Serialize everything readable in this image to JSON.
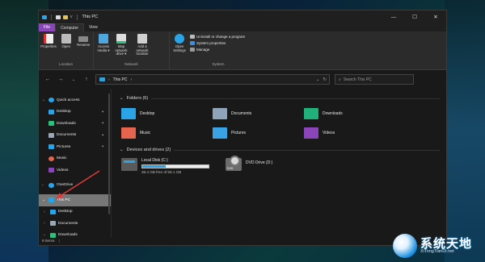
{
  "window": {
    "title": "This PC",
    "quick_access_caret": "v"
  },
  "window_controls": {
    "minimize": "—",
    "maximize": "☐",
    "close": "✕"
  },
  "tabs": [
    {
      "label": "File"
    },
    {
      "label": "Computer"
    },
    {
      "label": "View"
    }
  ],
  "ribbon": {
    "location": {
      "label": "Location",
      "buttons": [
        {
          "label": "Properties"
        },
        {
          "label": "Open"
        },
        {
          "label": "Rename"
        }
      ]
    },
    "network": {
      "label": "Network",
      "buttons": [
        {
          "label": "Access media ▾"
        },
        {
          "label": "Map network drive ▾"
        },
        {
          "label": "Add a network location"
        }
      ]
    },
    "system": {
      "label": "System",
      "open_settings": "Open Settings",
      "items": [
        {
          "label": "Uninstall or change a program"
        },
        {
          "label": "System properties"
        },
        {
          "label": "Manage"
        }
      ]
    }
  },
  "address": {
    "path": "This PC",
    "search_placeholder": "Search This PC"
  },
  "sidebar": {
    "items": [
      {
        "label": "Quick access",
        "icon": "star-icon",
        "color": "#2aa4e6"
      },
      {
        "label": "Desktop",
        "icon": "desktop-icon",
        "color": "#2aa4e6",
        "pinned": true
      },
      {
        "label": "Downloads",
        "icon": "downloads-icon",
        "color": "#2fbf7f",
        "pinned": true
      },
      {
        "label": "Documents",
        "icon": "documents-icon",
        "color": "#9aa7b5",
        "pinned": true
      },
      {
        "label": "Pictures",
        "icon": "pictures-icon",
        "color": "#2aa4e6",
        "pinned": true
      },
      {
        "label": "Music",
        "icon": "music-icon",
        "color": "#e5644e"
      },
      {
        "label": "Videos",
        "icon": "videos-icon",
        "color": "#8a46b8"
      },
      {
        "label": "OneDrive",
        "icon": "onedrive-icon",
        "color": "#2aa4e6"
      },
      {
        "label": "This PC",
        "icon": "this-pc-icon",
        "color": "#2aa4e6"
      },
      {
        "label": "Desktop",
        "icon": "desktop-icon",
        "color": "#2aa4e6"
      },
      {
        "label": "Documents",
        "icon": "documents-icon",
        "color": "#9aa7b5"
      },
      {
        "label": "Downloads",
        "icon": "downloads-icon",
        "color": "#2fbf7f"
      }
    ]
  },
  "folders": {
    "header": "Folders (6)",
    "items": [
      {
        "label": "Desktop",
        "icon": "desktop-folder-icon",
        "color": "#2aa4e6"
      },
      {
        "label": "Documents",
        "icon": "documents-folder-icon",
        "color": "#8fa4b8"
      },
      {
        "label": "Downloads",
        "icon": "downloads-folder-icon",
        "color": "#22b07a"
      },
      {
        "label": "Music",
        "icon": "music-folder-icon",
        "color": "#e5644e"
      },
      {
        "label": "Pictures",
        "icon": "pictures-folder-icon",
        "color": "#3aa3e6"
      },
      {
        "label": "Videos",
        "icon": "videos-folder-icon",
        "color": "#8a46b8"
      }
    ]
  },
  "drives": {
    "header": "Devices and drives (2)",
    "local": {
      "label": "Local Disk (C:)",
      "free": "38.4 GB free of 59.1 GB",
      "used_fraction": 0.35
    },
    "dvd": {
      "label": "DVD Drive (D:)",
      "badge": "DVD"
    }
  },
  "status": {
    "items": "8 items"
  },
  "watermark": {
    "cn": "系统天地",
    "en": "XiTongTianDi.net"
  }
}
